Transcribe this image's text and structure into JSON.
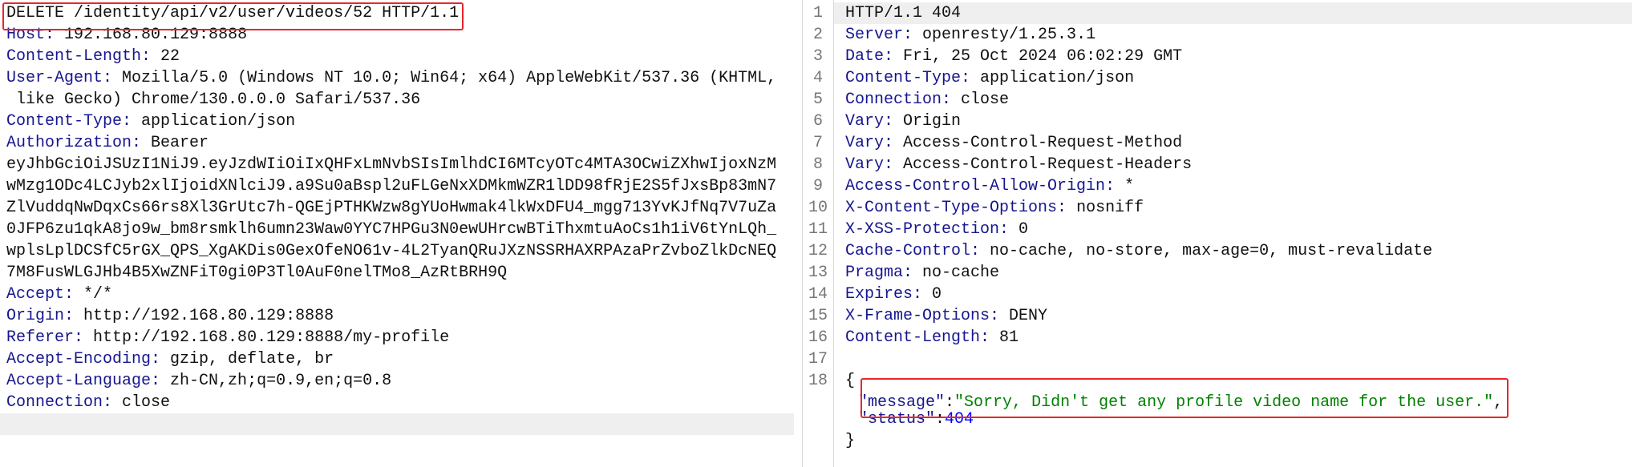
{
  "request": {
    "request_line": "DELETE /identity/api/v2/user/videos/52 HTTP/1.1",
    "headers_before_auth": [
      {
        "key": "Host",
        "value": "192.168.80.129:8888"
      },
      {
        "key": "Content-Length",
        "value": "22"
      },
      {
        "key": "User-Agent",
        "value": "Mozilla/5.0 (Windows NT 10.0; Win64; x64) AppleWebKit/537.36 (KHTML,"
      }
    ],
    "user_agent_continuation": " like Gecko) Chrome/130.0.0.0 Safari/537.36",
    "content_type": {
      "key": "Content-Type",
      "value": "application/json"
    },
    "authorization": {
      "key": "Authorization",
      "value": "Bearer"
    },
    "token_lines": [
      "eyJhbGciOiJSUzI1NiJ9.eyJzdWIiOiIxQHFxLmNvbSIsImlhdCI6MTcyOTc4MTA3OCwiZXhwIjoxNzM",
      "wMzg1ODc4LCJyb2xlIjoidXNlciJ9.a9Su0aBspl2uFLGeNxXDMkmWZR1lDD98fRjE2S5fJxsBp83mN7",
      "ZlVuddqNwDqxCs66rs8Xl3GrUtc7h-QGEjPTHKWzw8gYUoHwmak4lkWxDFU4_mgg713YvKJfNq7V7uZa",
      "0JFP6zu1qkA8jo9w_bm8rsmklh6umn23Waw0YYC7HPGu3N0ewUHrcwBTiThxmtuAoCs1h1iV6tYnLQh_",
      "wplsLplDCSfC5rGX_QPS_XgAKDis0GexOfeNO61v-4L2TyanQRuJXzNSSRHAXRPAzaPrZvboZlkDcNEQ",
      "7M8FusWLGJHb4B5XwZNFiT0gi0P3Tl0AuF0nelTMo8_AzRtBRH9Q"
    ],
    "headers_after_auth": [
      {
        "key": "Accept",
        "value": "*/*"
      },
      {
        "key": "Origin",
        "value": "http://192.168.80.129:8888"
      },
      {
        "key": "Referer",
        "value": "http://192.168.80.129:8888/my-profile"
      },
      {
        "key": "Accept-Encoding",
        "value": "gzip, deflate, br"
      },
      {
        "key": "Accept-Language",
        "value": "zh-CN,zh;q=0.9,en;q=0.8"
      },
      {
        "key": "Connection",
        "value": "close"
      }
    ]
  },
  "response": {
    "line_numbers": [
      "1",
      "2",
      "3",
      "4",
      "5",
      "6",
      "7",
      "8",
      "9",
      "10",
      "11",
      "12",
      "13",
      "14",
      "15",
      "16",
      "17",
      "18"
    ],
    "status_line": "HTTP/1.1 404",
    "headers": [
      {
        "key": "Server",
        "value": "openresty/1.25.3.1"
      },
      {
        "key": "Date",
        "value": "Fri, 25 Oct 2024 06:02:29 GMT"
      },
      {
        "key": "Content-Type",
        "value": "application/json"
      },
      {
        "key": "Connection",
        "value": "close"
      },
      {
        "key": "Vary",
        "value": "Origin"
      },
      {
        "key": "Vary",
        "value": "Access-Control-Request-Method"
      },
      {
        "key": "Vary",
        "value": "Access-Control-Request-Headers"
      },
      {
        "key": "Access-Control-Allow-Origin",
        "value": "*"
      },
      {
        "key": "X-Content-Type-Options",
        "value": "nosniff"
      },
      {
        "key": "X-XSS-Protection",
        "value": "0"
      },
      {
        "key": "Cache-Control",
        "value": "no-cache, no-store, max-age=0, must-revalidate"
      },
      {
        "key": "Pragma",
        "value": "no-cache"
      },
      {
        "key": "Expires",
        "value": "0"
      },
      {
        "key": "X-Frame-Options",
        "value": "DENY"
      },
      {
        "key": "Content-Length",
        "value": "81"
      }
    ],
    "body": {
      "open_brace": "{",
      "message_key": "\"message\"",
      "message_value": "\"Sorry, Didn't get any profile video name for the user.\"",
      "status_key": "\"status\"",
      "status_value": "404",
      "close_brace": "}"
    }
  },
  "colors": {
    "highlight_box": "#e8262a",
    "header_key": "#16168f",
    "json_string": "#008000",
    "json_number": "#0000ff"
  }
}
